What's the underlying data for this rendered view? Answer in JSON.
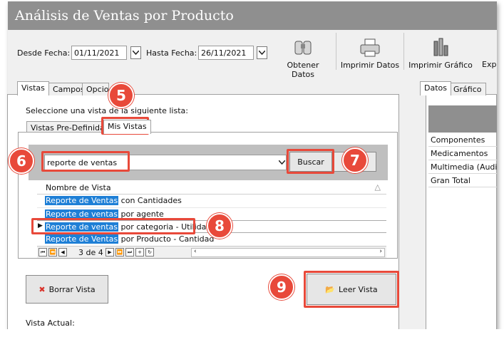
{
  "window": {
    "title": "Análisis de Ventas por Producto"
  },
  "toolbar": {
    "desde_label": "Desde Fecha:",
    "desde_value": "01/11/2021",
    "hasta_label": "Hasta Fecha:",
    "hasta_value": "26/11/2021",
    "obtener": "Obtener Datos",
    "imprimir_datos": "Imprimir Datos",
    "imprimir_grafico": "Imprimir Gráfico",
    "exportar_partial": "Exp"
  },
  "main_tabs": [
    "Vistas",
    "Campos",
    "Opcio"
  ],
  "instruction": "Seleccione una vista de la siguiente lista:",
  "sub_tabs": [
    "Vistas Pre-Definidas",
    "Mis Vistas"
  ],
  "search": {
    "value": "reporte de ventas",
    "button": "Buscar"
  },
  "grid": {
    "header": "Nombre de Vista",
    "rows": [
      {
        "match": "Reporte de Ventas",
        "rest": " con Cantidades"
      },
      {
        "match": "Reporte de ventas",
        "rest": " por agente"
      },
      {
        "match": "Reporte de ventas",
        "rest": " por categoria - Utilidad"
      },
      {
        "match": "Reporte de Ventas",
        "rest": " por Producto - Cantidad"
      }
    ],
    "pager": "3 de 4"
  },
  "buttons": {
    "borrar": "Borrar Vista",
    "leer": "Leer Vista"
  },
  "vista_actual": "Vista Actual:",
  "right_tabs": [
    "Datos",
    "Gráfico"
  ],
  "right_rows": [
    "Componentes",
    "Medicamentos",
    "Multimedia (Audio y",
    "Gran Total"
  ],
  "badges": [
    "5",
    "6",
    "7",
    "8",
    "9"
  ],
  "colors": {
    "titlebar": "#8f8f8f",
    "highlight": "#1e7fd6",
    "callout": "#e8493a"
  }
}
